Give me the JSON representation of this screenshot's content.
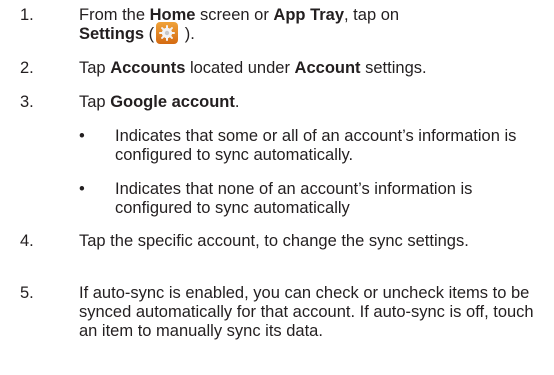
{
  "steps": [
    {
      "num": "1.",
      "parts": [
        "From the ",
        "Home",
        " screen or ",
        "App Tray",
        ", tap on ",
        "Settings",
        " (",
        " )."
      ]
    },
    {
      "num": "2.",
      "parts": [
        "Tap ",
        "Accounts",
        " located under ",
        "Account",
        " settings."
      ]
    },
    {
      "num": "3.",
      "parts": [
        "Tap ",
        "Google account",
        "."
      ]
    },
    {
      "num": "4.",
      "text": "Tap the specific account, to change the sync settings."
    },
    {
      "num": "5.",
      "text": "If auto-sync is enabled, you can check or uncheck items to be synced automatically for that account. If auto-sync is off, touch an item to manually sync its data."
    }
  ],
  "bullets": [
    {
      "mark": "•",
      "text": "Indicates that some or all of an account’s information is configured to sync automatically."
    },
    {
      "mark": "•",
      "text": "Indicates that none of an account’s information is configured to sync automatically"
    }
  ],
  "icons": {
    "settings": "settings-gear-icon"
  },
  "colors": {
    "text": "#231f20",
    "settings_icon": "#e0852a"
  }
}
